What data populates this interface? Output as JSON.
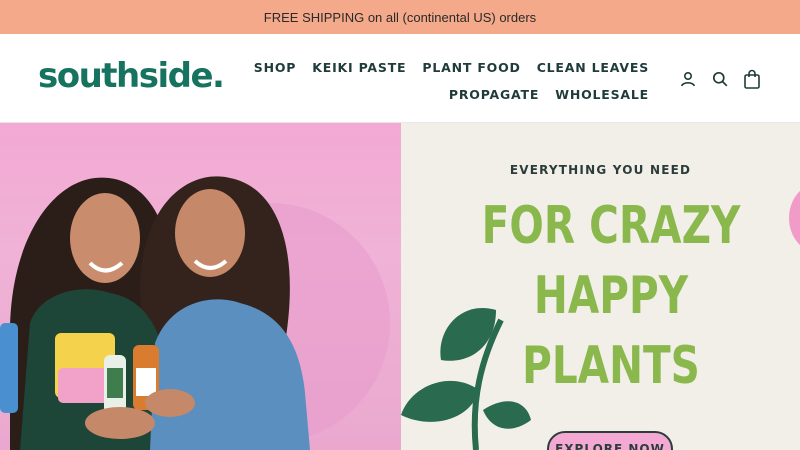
{
  "announcement": {
    "text": "FREE SHIPPING on all (continental US) orders"
  },
  "header": {
    "logo": "southside.",
    "nav_row1": [
      "SHOP",
      "KEIKI PASTE",
      "PLANT FOOD",
      "CLEAN LEAVES"
    ],
    "nav_row2": [
      "PROPAGATE",
      "WHOLESALE"
    ],
    "icons": [
      "account-icon",
      "search-icon",
      "cart-icon"
    ]
  },
  "hero": {
    "eyebrow": "EVERYTHING YOU NEED",
    "headline": [
      "FOR CRAZY",
      "HAPPY",
      "PLANTS"
    ],
    "cta": "EXPLORE NOW"
  },
  "colors": {
    "brand_green": "#16735f",
    "headline_green": "#8bb84d",
    "announcement_bg": "#f4a98a",
    "hero_pink": "#f3a9d4",
    "hero_cream": "#f2efe9",
    "leaf_green": "#2a6b4f",
    "text_dark": "#1f3b3a"
  }
}
